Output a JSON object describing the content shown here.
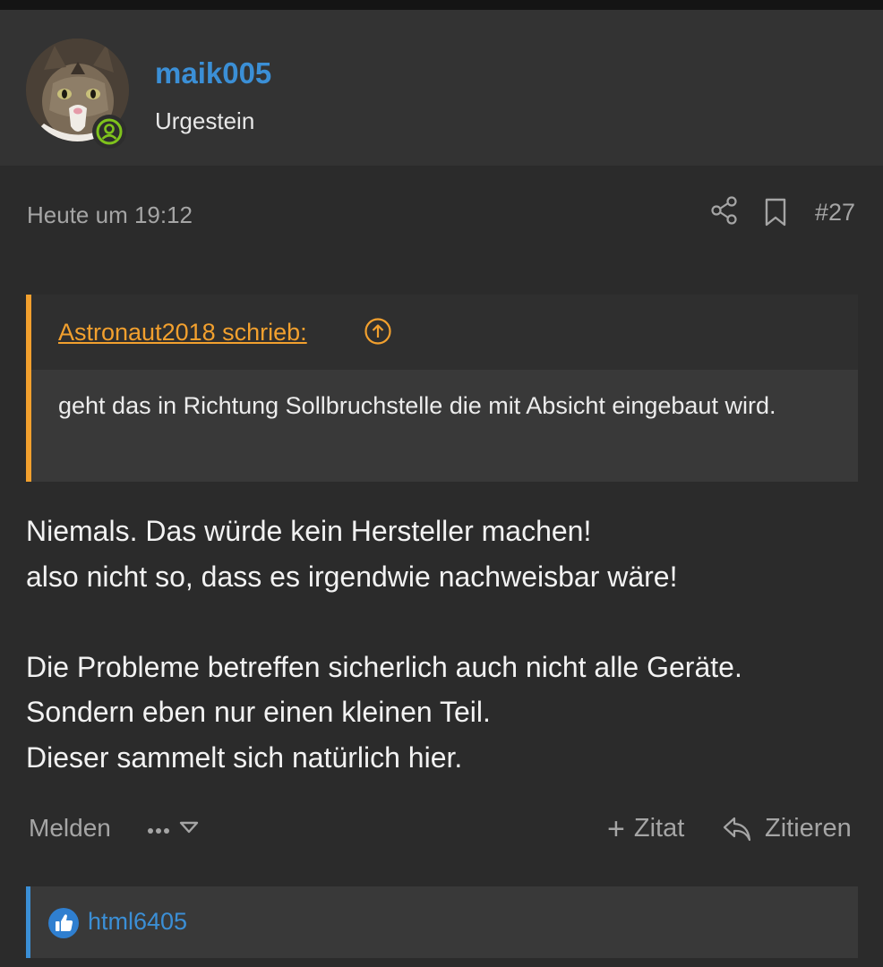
{
  "post": {
    "author": {
      "username": "maik005",
      "title": "Urgestein",
      "avatar_icon": "cat-avatar",
      "status_icon": "online-user-icon"
    },
    "date": "Heute um 19:12",
    "number": "#27",
    "actions_icons": [
      "share-icon",
      "bookmark-icon"
    ]
  },
  "quote": {
    "author_label": "Astronaut2018 schrieb:",
    "jump_icon": "arrow-up-circle-icon",
    "text": "geht das in Richtung Sollbruchstelle die mit Absicht eingebaut wird."
  },
  "message": {
    "lines": [
      "Niemals. Das würde kein Hersteller machen!",
      "also nicht so, dass es irgendwie nachweisbar wäre!",
      "",
      "Die Probleme betreffen sicherlich auch nicht alle Geräte.",
      "Sondern eben nur einen kleinen Teil.",
      "Dieser sammelt sich natürlich hier."
    ]
  },
  "footer": {
    "report_label": "Melden",
    "more_icon": "more-dots-icon",
    "add_quote_symbol": "+",
    "add_quote_label": "Zitat",
    "reply_label": "Zitieren",
    "reply_icon": "reply-arrow-icon"
  },
  "reactions": {
    "icon": "thumbs-up-icon",
    "users": "html6405"
  },
  "colors": {
    "accent_blue": "#3b8fd6",
    "quote_orange": "#f2a02e",
    "online_green": "#7fc31c"
  }
}
